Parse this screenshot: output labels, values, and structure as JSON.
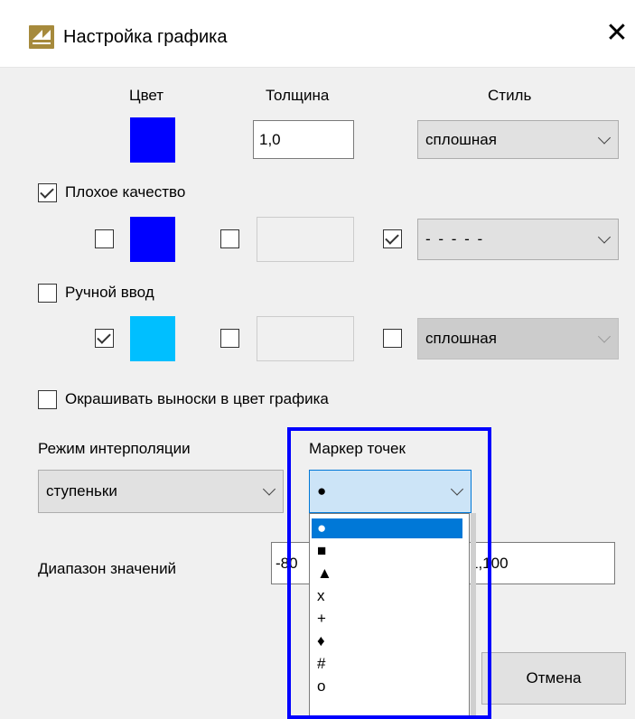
{
  "window": {
    "title": "Настройка графика"
  },
  "main": {
    "color_label": "Цвет",
    "thickness_label": "Толщина",
    "style_label": "Стиль",
    "thickness_value": "1,0",
    "style_value": "сплошная",
    "main_color": "#0000ff"
  },
  "bad_quality": {
    "label": "Плохое качество",
    "color": "#0000ff",
    "style_value": "- - - - -"
  },
  "manual_input": {
    "label": "Ручной ввод",
    "color": "#00bfff",
    "style_value": "сплошная"
  },
  "callouts": {
    "label": "Окрашивать выноски в цвет графика"
  },
  "interpolation": {
    "label": "Режим интерполяции",
    "value": "ступеньки"
  },
  "marker": {
    "label": "Маркер точек",
    "value": "●",
    "options": [
      "●",
      "■",
      "▲",
      "x",
      "+",
      "♦",
      "#",
      "o"
    ]
  },
  "range": {
    "label": "Диапазон значений",
    "min_fragment": "-80",
    "max_fragment": "1,100"
  },
  "buttons": {
    "cancel": "Отмена"
  }
}
